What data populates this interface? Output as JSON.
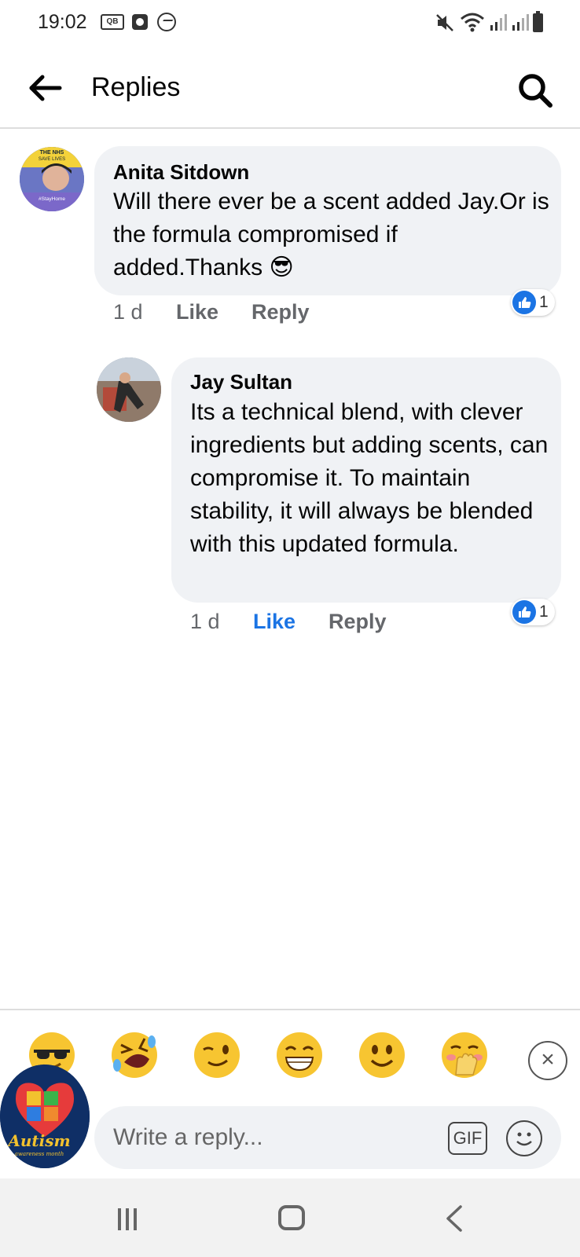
{
  "status_bar": {
    "time": "19:02",
    "voicemail_label": "QB"
  },
  "header": {
    "title": "Replies"
  },
  "comments": [
    {
      "author": "Anita Sitdown",
      "text": "Will there ever be a scent added Jay.Or is the formula compromised if added.Thanks",
      "emoji": "😎",
      "avatar_text": {
        "top": "THE NHS",
        "middle": "SAVE LIVES",
        "bottom": "#StayHome"
      },
      "time": "1 d",
      "like_label": "Like",
      "reply_label": "Reply",
      "reaction_count": "1",
      "liked": false
    },
    {
      "author": "Jay Sultan",
      "text": "Its a technical blend, with clever ingredients but adding scents, can compromise it. To maintain stability, it will always be blended with this updated formula.",
      "time": "1 d",
      "like_label": "Like",
      "reply_label": "Reply",
      "reaction_count": "1",
      "liked": true
    }
  ],
  "composer": {
    "placeholder": "Write a reply...",
    "gif_label": "GIF",
    "quick_emojis": [
      "😎",
      "🤣",
      "😉",
      "😁",
      "🙂",
      "🤭"
    ],
    "close_label": "×",
    "user_avatar_text": "Autism",
    "user_avatar_subtext": "awareness month"
  },
  "colors": {
    "link_blue": "#1b74e4",
    "bubble_gray": "#f0f2f5",
    "meta_gray": "#65676b"
  }
}
